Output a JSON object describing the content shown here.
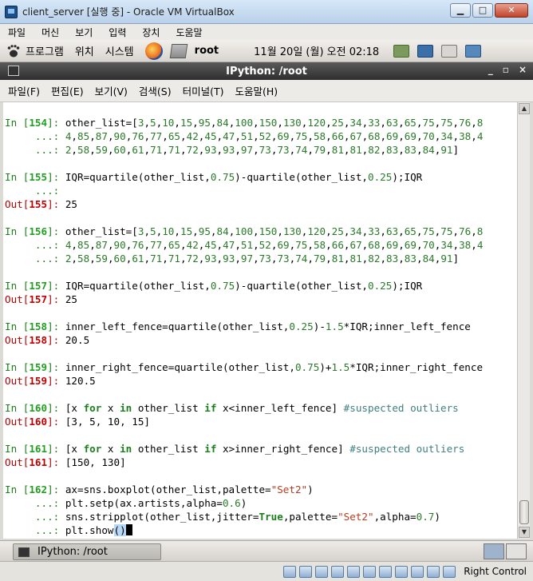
{
  "vbox": {
    "title": "client_server [실행 중] - Oracle VM VirtualBox",
    "controls": {
      "minimize": "▁",
      "maximize": "□",
      "close": "✕"
    },
    "menu": [
      "파일",
      "머신",
      "보기",
      "입력",
      "장치",
      "도움말"
    ],
    "status": {
      "host_key": "Right Control"
    }
  },
  "gnome_panel": {
    "menus": [
      "프로그램",
      "위치",
      "시스템"
    ],
    "user": "root",
    "clock": "11월 20일 (월) 오전 02:18"
  },
  "terminal": {
    "title": "IPython: /root",
    "controls": {
      "minimize": "_",
      "maximize": "▫",
      "close": "×"
    },
    "menu": [
      "파일(F)",
      "편집(E)",
      "보기(V)",
      "검색(S)",
      "터미널(T)",
      "도움말(H)"
    ],
    "lines": [
      "In [154]: other_list=[3,5,10,15,95,84,100,150,130,120,25,34,33,63,65,75,75,76,8",
      "     ...: 4,85,87,90,76,77,65,42,45,47,51,52,69,75,58,66,67,68,69,69,70,34,38,4",
      "     ...: 2,58,59,60,61,71,71,72,93,93,97,73,73,74,79,81,81,82,83,83,84,91]",
      "In [155]: IQR=quartile(other_list,0.75)-quartile(other_list,0.25);IQR",
      "     ...:",
      "Out[155]: 25",
      "In [156]: other_list=[3,5,10,15,95,84,100,150,130,120,25,34,33,63,65,75,75,76,8",
      "     ...: 4,85,87,90,76,77,65,42,45,47,51,52,69,75,58,66,67,68,69,69,70,34,38,4",
      "     ...: 2,58,59,60,61,71,71,72,93,93,97,73,73,74,79,81,81,82,83,83,84,91]",
      "In [157]: IQR=quartile(other_list,0.75)-quartile(other_list,0.25);IQR",
      "Out[157]: 25",
      "In [158]: inner_left_fence=quartile(other_list,0.25)-1.5*IQR;inner_left_fence",
      "Out[158]: 20.5",
      "In [159]: inner_right_fence=quartile(other_list,0.75)+1.5*IQR;inner_right_fence",
      "Out[159]: 120.5",
      "In [160]: [x for x in other_list if x<inner_left_fence] #suspected outliers",
      "Out[160]: [3, 5, 10, 15]",
      "In [161]: [x for x in other_list if x>inner_right_fence] #suspected outliers",
      "Out[161]: [150, 130]",
      "In [162]: ax=sns.boxplot(other_list,palette=\"Set2\")",
      "     ...: plt.setp(ax.artists,alpha=0.6)",
      "     ...: sns.stripplot(other_list,jitter=True,palette=\"Set2\",alpha=0.7)",
      "     ...: plt.show()"
    ]
  },
  "taskbar": {
    "task_label": "IPython: /root"
  }
}
